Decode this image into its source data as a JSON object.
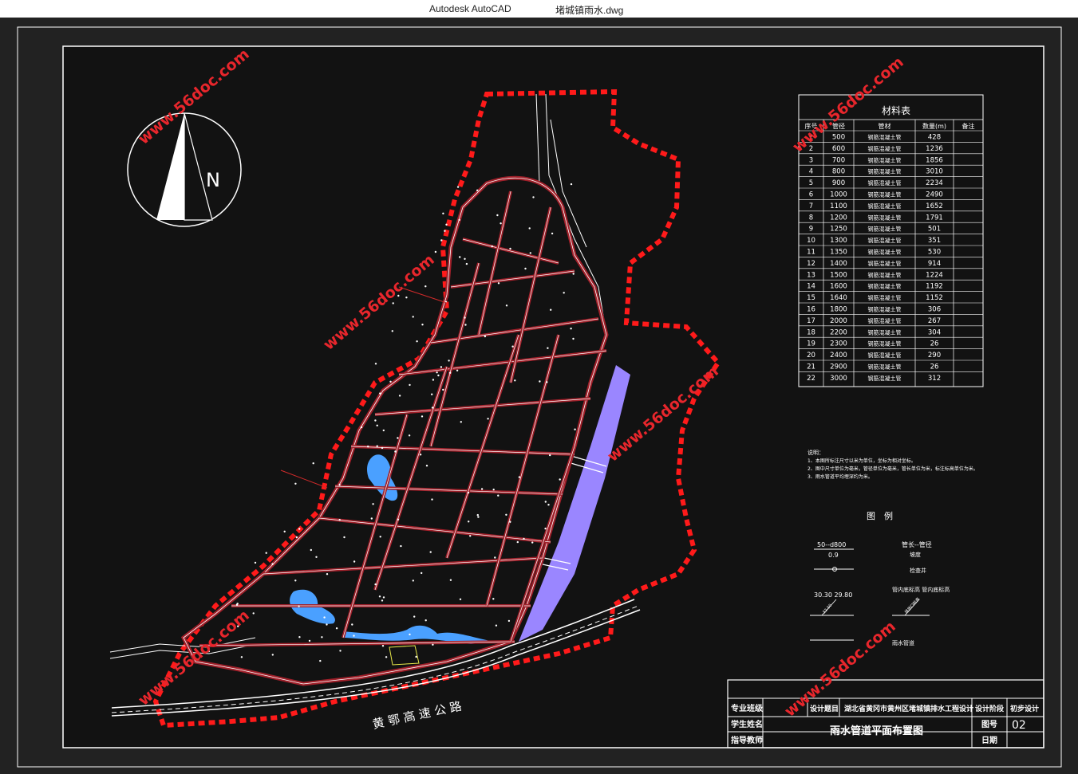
{
  "window": {
    "app_name": "Autodesk AutoCAD",
    "document_name": "堵城镇雨水.dwg"
  },
  "drawing": {
    "compass_label": "N",
    "highway_label": "黄 鄂 高 速 公 路",
    "watermark": "www.56doc.com",
    "colors": {
      "background": "#222222",
      "boundary": "#ff1a1a",
      "pipes": "#a0202a",
      "roads": "#ffffff",
      "ponds": "#4aa0ff",
      "river_strip": "#9a86ff"
    }
  },
  "materials_table": {
    "title": "材料表",
    "headers": [
      "序号",
      "管径",
      "管材",
      "数量(m)",
      "备注"
    ],
    "rows": [
      {
        "no": "1",
        "dia": "500",
        "mat": "钢筋混凝土管",
        "qty": "428"
      },
      {
        "no": "2",
        "dia": "600",
        "mat": "钢筋混凝土管",
        "qty": "1236"
      },
      {
        "no": "3",
        "dia": "700",
        "mat": "钢筋混凝土管",
        "qty": "1856"
      },
      {
        "no": "4",
        "dia": "800",
        "mat": "钢筋混凝土管",
        "qty": "3010"
      },
      {
        "no": "5",
        "dia": "900",
        "mat": "钢筋混凝土管",
        "qty": "2234"
      },
      {
        "no": "6",
        "dia": "1000",
        "mat": "钢筋混凝土管",
        "qty": "2490"
      },
      {
        "no": "7",
        "dia": "1100",
        "mat": "钢筋混凝土管",
        "qty": "1652"
      },
      {
        "no": "8",
        "dia": "1200",
        "mat": "钢筋混凝土管",
        "qty": "1791"
      },
      {
        "no": "9",
        "dia": "1250",
        "mat": "钢筋混凝土管",
        "qty": "501"
      },
      {
        "no": "10",
        "dia": "1300",
        "mat": "钢筋混凝土管",
        "qty": "351"
      },
      {
        "no": "11",
        "dia": "1350",
        "mat": "钢筋混凝土管",
        "qty": "530"
      },
      {
        "no": "12",
        "dia": "1400",
        "mat": "钢筋混凝土管",
        "qty": "914"
      },
      {
        "no": "13",
        "dia": "1500",
        "mat": "钢筋混凝土管",
        "qty": "1224"
      },
      {
        "no": "14",
        "dia": "1600",
        "mat": "钢筋混凝土管",
        "qty": "1192"
      },
      {
        "no": "15",
        "dia": "1640",
        "mat": "钢筋混凝土管",
        "qty": "1152"
      },
      {
        "no": "16",
        "dia": "1800",
        "mat": "钢筋混凝土管",
        "qty": "306"
      },
      {
        "no": "17",
        "dia": "2000",
        "mat": "钢筋混凝土管",
        "qty": "267"
      },
      {
        "no": "18",
        "dia": "2200",
        "mat": "钢筋混凝土管",
        "qty": "304"
      },
      {
        "no": "19",
        "dia": "2300",
        "mat": "钢筋混凝土管",
        "qty": "26"
      },
      {
        "no": "20",
        "dia": "2400",
        "mat": "钢筋混凝土管",
        "qty": "290"
      },
      {
        "no": "21",
        "dia": "2900",
        "mat": "钢筋混凝土管",
        "qty": "26"
      },
      {
        "no": "22",
        "dia": "3000",
        "mat": "钢筋混凝土管",
        "qty": "312"
      }
    ]
  },
  "notes": {
    "title": "说明：",
    "lines": [
      "1、本图所标注尺寸以米为单位，坐标为相对坐标。",
      "2、图中尺寸单位为毫米，管径单位为毫米，管长单位为米，标注标高单位为米。",
      "3、雨水管道平均埋深约为米。"
    ]
  },
  "legend": {
    "title": "图　例",
    "pipe_label_top": "50--d800",
    "pipe_label_bottom": "0.9",
    "pipe_label_desc": "管长--管径",
    "slope_desc": "坡度",
    "manhole_desc": "检查井",
    "elev_label": "30.30  29.80",
    "elev_desc": "管内底标高  管内底标高",
    "outlet_desc": "雨水管道",
    "small_a": "32.50",
    "small_b": "排放口标高"
  },
  "title_block": {
    "major_label": "专业班级",
    "student_label": "学生姓名",
    "advisor_label": "指导教师",
    "topic_label": "设计题目",
    "topic_value": "湖北省黄冈市黄州区堵城镇排水工程设计",
    "stage_label": "设计阶段",
    "stage_value": "初步设计",
    "drawing_title": "雨水管道平面布置图",
    "drawing_no_label": "图号",
    "drawing_no_value": "02",
    "date_label": "日期"
  }
}
